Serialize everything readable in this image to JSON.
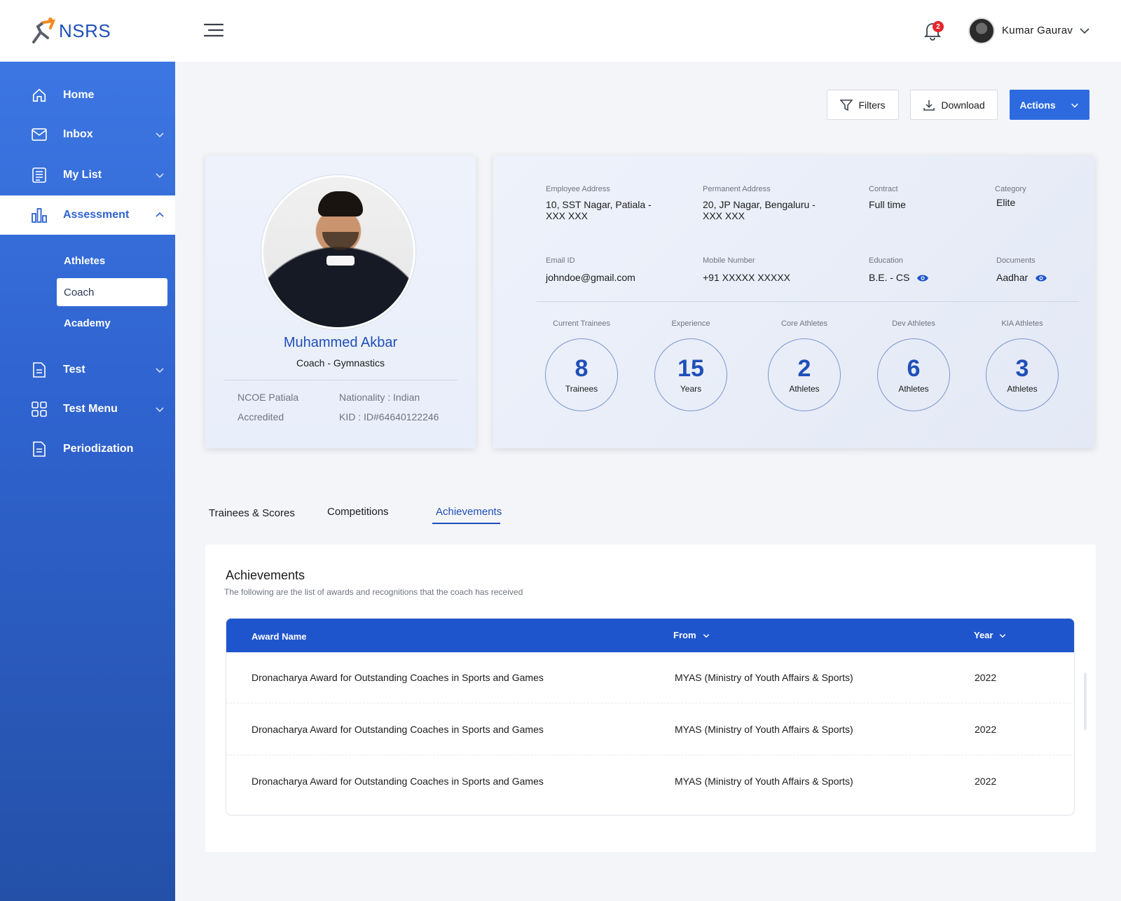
{
  "app": {
    "logo_text": "NSRS"
  },
  "sidebar": {
    "items": [
      {
        "label": "Home",
        "icon": "home-icon"
      },
      {
        "label": "Inbox",
        "icon": "mail-icon"
      },
      {
        "label": "My List",
        "icon": "list-icon"
      },
      {
        "label": "Assessment",
        "icon": "bar-chart-icon"
      },
      {
        "label": "Test",
        "icon": "document-icon"
      },
      {
        "label": "Test Menu",
        "icon": "grid-icon"
      },
      {
        "label": "Periodization",
        "icon": "document-icon"
      }
    ],
    "sub_items": [
      "Athletes",
      "Coach",
      "Academy"
    ]
  },
  "header": {
    "notification_count": "2",
    "user_name": "Kumar Gaurav"
  },
  "toolbar": {
    "filters_label": "Filters",
    "download_label": "Download",
    "actions_label": "Actions"
  },
  "profile": {
    "name": "Muhammed Akbar",
    "role": "Coach - Gymnastics",
    "center": "NCOE Patiala",
    "status": "Accredited",
    "nationality": "Nationality : Indian",
    "kid": "KID : ID#64640122246"
  },
  "details": {
    "employee_address_label": "Employee Address",
    "employee_address": "10, SST Nagar, Patiala - XXX XXX",
    "permanent_address_label": "Permanent Address",
    "permanent_address": "20, JP Nagar, Bengaluru - XXX XXX",
    "contract_label": "Contract",
    "contract": "Full time",
    "category_label": "Category",
    "category": "Elite",
    "email_label": "Email ID",
    "email": "johndoe@gmail.com",
    "mobile_label": "Mobile Number",
    "mobile": "+91 XXXXX XXXXX",
    "education_label": "Education",
    "education": "B.E. - CS",
    "documents_label": "Documents",
    "documents": "Aadhar"
  },
  "stats": [
    {
      "label": "Current Trainees",
      "value": "8",
      "unit": "Trainees"
    },
    {
      "label": "Experience",
      "value": "15",
      "unit": "Years"
    },
    {
      "label": "Core Athletes",
      "value": "2",
      "unit": "Athletes"
    },
    {
      "label": "Dev Athletes",
      "value": "6",
      "unit": "Athletes"
    },
    {
      "label": "KIA Athletes",
      "value": "3",
      "unit": "Athletes"
    }
  ],
  "tabs": [
    "Trainees & Scores",
    "Competitions",
    "Achievements"
  ],
  "achievements": {
    "title": "Achievements",
    "subtitle": "The following are the list of awards and recognitions that the coach has received",
    "columns": [
      "Award Name",
      "From",
      "Year"
    ],
    "rows": [
      [
        "Dronacharya Award for Outstanding Coaches in Sports and Games",
        "MYAS (Ministry of Youth Affairs & Sports)",
        "2022"
      ],
      [
        "Dronacharya Award for Outstanding Coaches in Sports and Games",
        "MYAS (Ministry of Youth Affairs & Sports)",
        "2022"
      ],
      [
        "Dronacharya Award for Outstanding Coaches in Sports and Games",
        "MYAS (Ministry of Youth Affairs & Sports)",
        "2022"
      ]
    ]
  },
  "colors": {
    "primary": "#2d6ae0",
    "brand_blue": "#1f4fb9",
    "logo_orange": "#f28a1e"
  }
}
